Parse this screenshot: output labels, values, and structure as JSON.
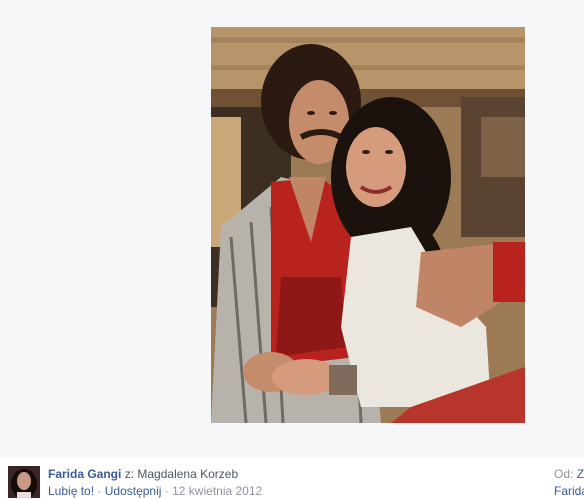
{
  "post": {
    "author": "Farida Gangi",
    "from_prefix": "z:",
    "from_name": "Magdalena Korzeb",
    "like": "Lubię to!",
    "sep1": "·",
    "share": "Udostępnij",
    "sep2": "·",
    "date": "12 kwietnia 2012"
  },
  "side": {
    "from_label": "Od:",
    "from_value": "Z",
    "name_fragment": "Farida"
  },
  "colors": {
    "link": "#3b5998",
    "muted": "#90949c",
    "viewer_bg": "#f6f7f9"
  }
}
